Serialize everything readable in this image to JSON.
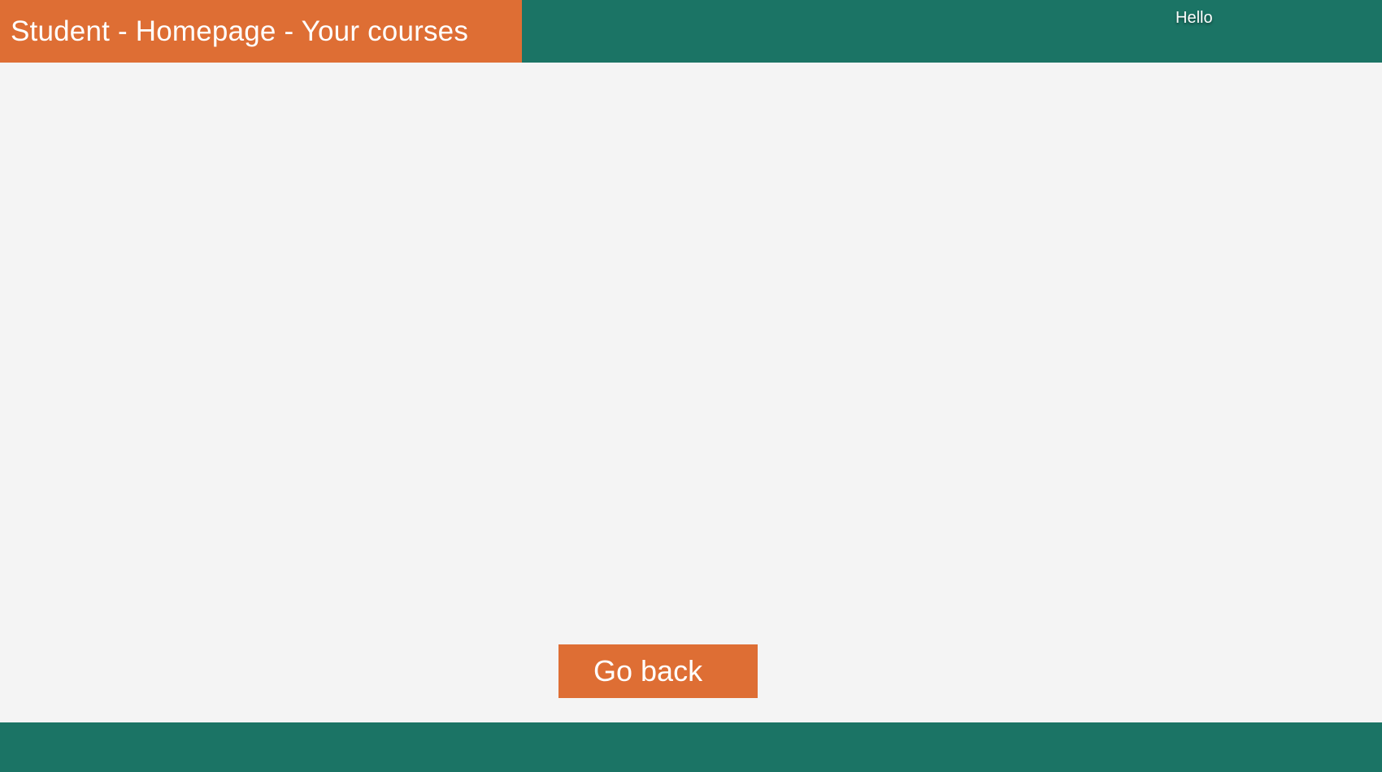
{
  "header": {
    "title": "Student - Homepage - Your courses",
    "greeting": "Hello"
  },
  "actions": {
    "go_back_label": "Go back"
  },
  "colors": {
    "header_bar": "#1b7465",
    "title_block": "#de6e34",
    "button": "#de6e34",
    "background": "#f4f4f4",
    "footer": "#1b7465"
  }
}
